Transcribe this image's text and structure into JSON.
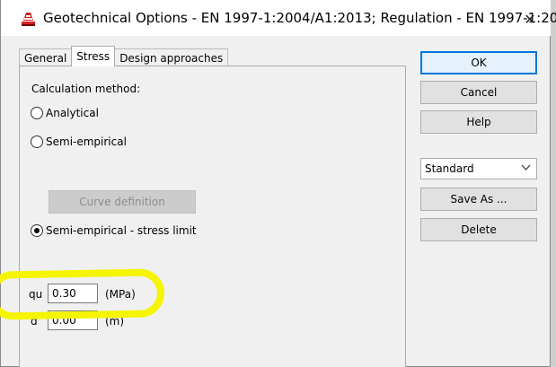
{
  "window": {
    "title": "Geotechnical Options - EN 1997-1:2004/A1:2013;   Regulation - EN 1997-1:20...",
    "close_glyph": "✕"
  },
  "tabs": [
    {
      "label": "General",
      "active": false
    },
    {
      "label": "Stress",
      "active": true
    },
    {
      "label": "Design approaches",
      "active": false
    }
  ],
  "stress": {
    "calc_method_label": "Calculation method:",
    "options": [
      {
        "label": "Analytical",
        "selected": false
      },
      {
        "label": "Semi-empirical",
        "selected": false
      },
      {
        "label": "Semi-empirical - stress limit",
        "selected": true
      }
    ],
    "curve_definition_label": "Curve definition",
    "qu": {
      "label": "qu",
      "value": "0.30",
      "unit": "(MPa)"
    },
    "d": {
      "label": "d",
      "value": "0.00",
      "unit": "(m)"
    }
  },
  "buttons": {
    "ok": "OK",
    "cancel": "Cancel",
    "help": "Help",
    "save_as": "Save As ...",
    "delete": "Delete"
  },
  "preset": {
    "selected": "Standard"
  },
  "colors": {
    "highlight": "#f5f500",
    "default_button_border": "#0078d7",
    "app_icon": "#d42020"
  },
  "icons": {
    "app": "geotechnical-app-icon",
    "close": "close-icon",
    "dropdown": "chevron-down-icon"
  }
}
